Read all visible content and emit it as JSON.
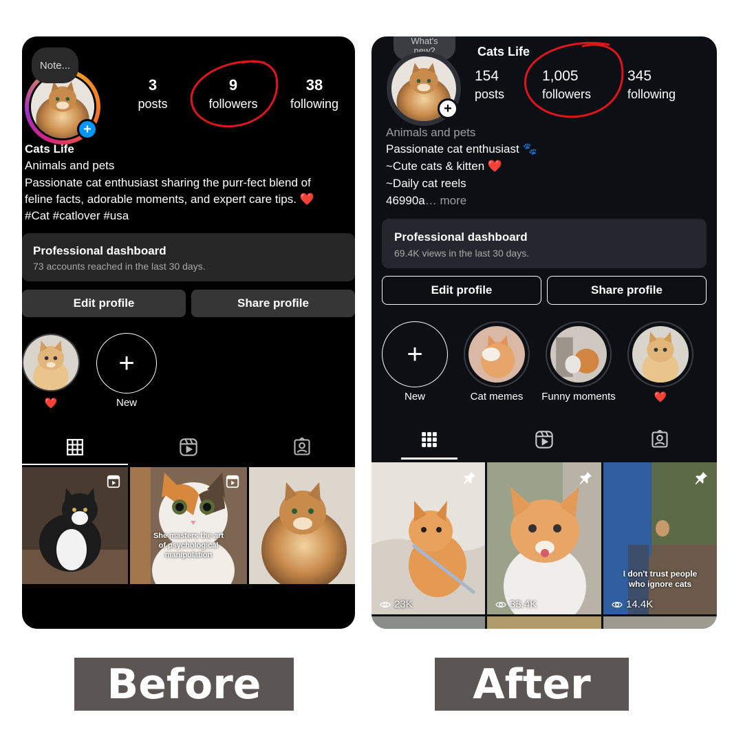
{
  "before": {
    "note": "Note...",
    "stats": [
      {
        "num": "3",
        "label": "posts"
      },
      {
        "num": "9",
        "label": "followers"
      },
      {
        "num": "38",
        "label": "following"
      }
    ],
    "name": "Cats Life",
    "category": "Animals and pets",
    "bio_lines": [
      "Passionate cat enthusiast sharing the purr-fect blend of",
      "feline facts, adorable moments, and expert care tips. ❤️",
      "#Cat #catlover #usa"
    ],
    "dashboard": {
      "title": "Professional dashboard",
      "subtitle": "73 accounts reached in the last 30 days."
    },
    "edit_label": "Edit profile",
    "share_label": "Share profile",
    "highlights": [
      {
        "label": "❤️"
      },
      {
        "label": "New"
      }
    ],
    "tiles": [
      {
        "caption": ""
      },
      {
        "caption": "She masters the art of psychological manipulation"
      },
      {
        "caption": ""
      }
    ]
  },
  "after": {
    "note": "What's new?",
    "name": "Cats Life",
    "stats": [
      {
        "num": "154",
        "label": "posts"
      },
      {
        "num": "1,005",
        "label": "followers"
      },
      {
        "num": "345",
        "label": "following"
      }
    ],
    "category": "Animals and pets",
    "bio_lines": [
      "Passionate cat enthusiast 🐾",
      "~Cute cats & kitten ❤️",
      "~Daily cat reels"
    ],
    "bio_more_prefix": "46990a",
    "bio_more_link": "… more",
    "dashboard": {
      "title": "Professional dashboard",
      "subtitle": "69.4K views in the last 30 days."
    },
    "edit_label": "Edit profile",
    "share_label": "Share profile",
    "highlights": [
      {
        "label": "New"
      },
      {
        "label": "Cat memes"
      },
      {
        "label": "Funny moments"
      },
      {
        "label": "❤️"
      }
    ],
    "tiles": [
      {
        "caption": "",
        "views": "23K"
      },
      {
        "caption": "",
        "views": "33.4K"
      },
      {
        "caption": "I don't trust people who ignore cats",
        "views": "14.4K"
      }
    ]
  },
  "labels": {
    "before": "Before",
    "after": "After"
  },
  "colors": {
    "accent_blue": "#0095f6",
    "annotation_red": "#e0151b",
    "label_box": "#5b5654"
  },
  "icons": [
    "plus-icon",
    "grid-icon",
    "reels-icon",
    "tagged-icon",
    "pin-icon",
    "eye-icon"
  ]
}
